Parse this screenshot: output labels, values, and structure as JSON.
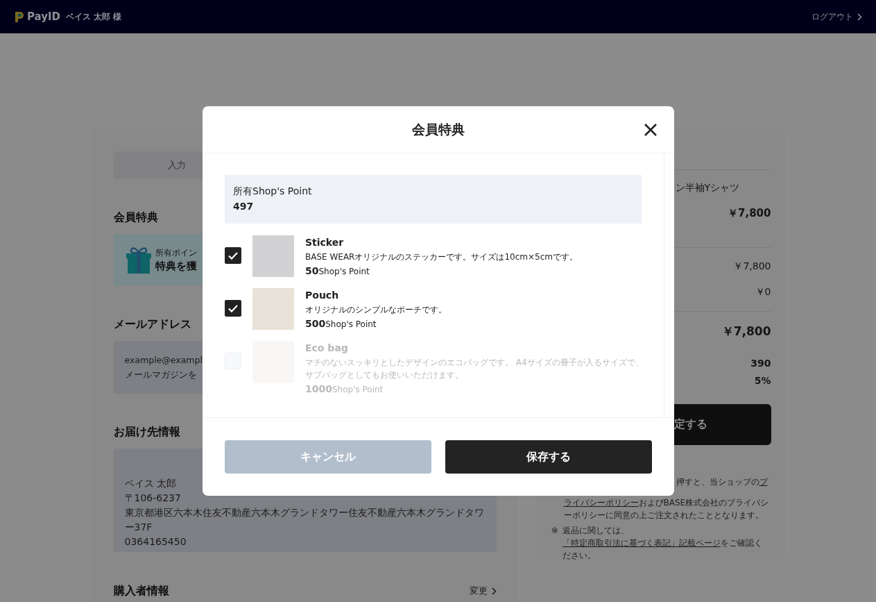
{
  "header": {
    "logo": "PayID",
    "user": "ベイス 太郎 様",
    "logout": "ログアウト"
  },
  "left": {
    "step_tab": "入力",
    "benefit_heading": "会員特典",
    "benefit_banner": {
      "line_1": "所有ポイン",
      "line_2": "特典を獲"
    },
    "email_heading": "メールアドレス",
    "email_lines": [
      "example@exampl",
      "メールマガジンを"
    ],
    "shipping_heading": "お届け先情報",
    "shipping_lines": [
      "ベイス 太郎",
      "〒106-6237",
      "東京都港区六本木住友不動産六本木グランドタワー住友不動産六本木グランドタワ",
      "ー37F",
      "0364165450"
    ],
    "buyer_heading": "購入者情報",
    "buyer_change": "変更"
  },
  "right": {
    "item_name": "ン半袖Yシャツ",
    "item_price": "￥7,800",
    "subtotal": "￥7,800",
    "shipping_fee": "￥0",
    "total": "￥7,800",
    "points": "390",
    "rate": "5%",
    "submit": "定する",
    "note_1": {
      "text": "押すと、当ショップの",
      "link": "プ"
    },
    "note_2": {
      "link": "ライバシーポリシー",
      "text": "およびBASE株式会社のプライバシーポリシーに同意の上ご注文されたこととなります。"
    },
    "note_3": {
      "mark": "※",
      "text": "返品に関しては、",
      "link": "「特定商取引法に基づく表記」記載ページ",
      "after": "をご確認ください。"
    }
  },
  "modal": {
    "title": "会員特典",
    "points_label": "所有Shop's Point",
    "points_value": "497",
    "items": [
      {
        "name": "Sticker",
        "description": "BASE WEARオリジナルのステッカーです。サイズは10cm×5cmです。",
        "points": "50",
        "unit": "Shop's Point",
        "checked": true,
        "disabled": false
      },
      {
        "name": "Pouch",
        "description": "オリジナルのシンプルなポーチです。",
        "points": "500",
        "unit": "Shop's Point",
        "checked": true,
        "disabled": false
      },
      {
        "name": "Eco bag",
        "description": "マチのないスッキリとしたデザインのエコバッグです。 A4サイズの冊子が入るサイズで、サブバッグとしてもお使いいただけます。",
        "points": "1000",
        "unit": "Shop's Point",
        "checked": false,
        "disabled": true
      }
    ],
    "cancel": "キャンセル",
    "save": "保存する"
  }
}
